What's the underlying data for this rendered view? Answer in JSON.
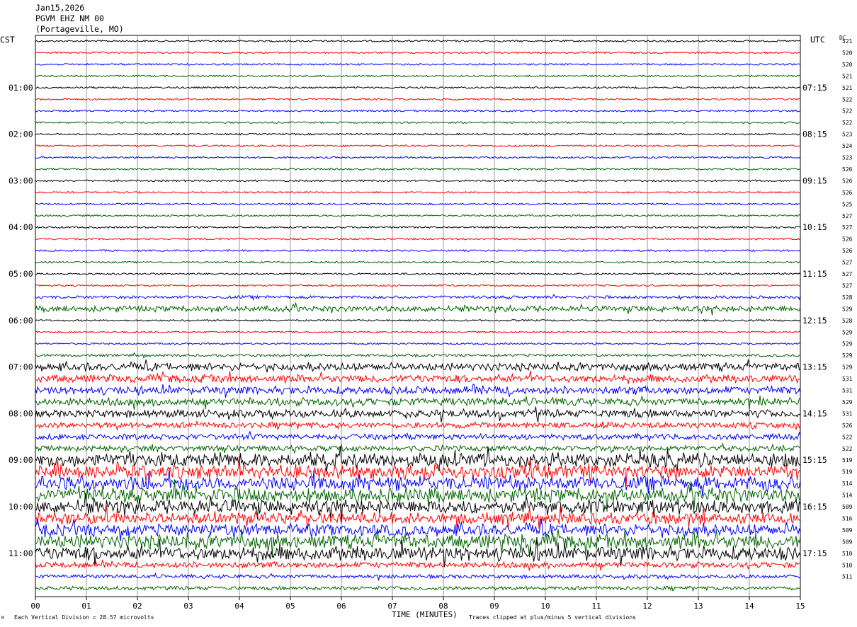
{
  "header": {
    "date": "Jan15,2026",
    "station": "PGVM EHZ NM 00",
    "location": "(Portageville, MO)"
  },
  "left_zone_label": "CST",
  "right_zone_label": "UTC",
  "dc_label": "DC",
  "footer": {
    "scale_note": "Each Vertical Division =   28.57 microvolts",
    "clip_note": "Traces clipped at plus/minus 5 vertical divisions",
    "corner_mark": "M"
  },
  "colors": {
    "trace_cycle": [
      "#000000",
      "#ff0000",
      "#0000ff",
      "#006400"
    ],
    "grid": "#808080"
  },
  "chart_data": {
    "type": "line",
    "title": "",
    "xlabel": "TIME (MINUTES)",
    "ylabel": "",
    "xlim": [
      0,
      15
    ],
    "x_ticks": [
      "00",
      "01",
      "02",
      "03",
      "04",
      "05",
      "06",
      "07",
      "08",
      "09",
      "10",
      "11",
      "12",
      "13",
      "14",
      "15"
    ],
    "rows": 48,
    "left_hour_labels": [
      {
        "row": 4,
        "label": "01:00"
      },
      {
        "row": 8,
        "label": "02:00"
      },
      {
        "row": 12,
        "label": "03:00"
      },
      {
        "row": 16,
        "label": "04:00"
      },
      {
        "row": 20,
        "label": "05:00"
      },
      {
        "row": 24,
        "label": "06:00"
      },
      {
        "row": 28,
        "label": "07:00"
      },
      {
        "row": 32,
        "label": "08:00"
      },
      {
        "row": 36,
        "label": "09:00"
      },
      {
        "row": 40,
        "label": "10:00"
      },
      {
        "row": 44,
        "label": "11:00"
      }
    ],
    "right_hour_labels": [
      {
        "row": 4,
        "label": "07:15"
      },
      {
        "row": 8,
        "label": "08:15"
      },
      {
        "row": 12,
        "label": "09:15"
      },
      {
        "row": 16,
        "label": "10:15"
      },
      {
        "row": 20,
        "label": "11:15"
      },
      {
        "row": 24,
        "label": "12:15"
      },
      {
        "row": 28,
        "label": "13:15"
      },
      {
        "row": 32,
        "label": "14:15"
      },
      {
        "row": 36,
        "label": "15:15"
      },
      {
        "row": 40,
        "label": "16:15"
      },
      {
        "row": 44,
        "label": "17:15"
      }
    ],
    "dc_offsets": [
      "521",
      "520",
      "520",
      "521",
      "521",
      "522",
      "522",
      "522",
      "523",
      "524",
      "523",
      "526",
      "526",
      "526",
      "525",
      "527",
      "527",
      "526",
      "526",
      "527",
      "527",
      "527",
      "528",
      "529",
      "528",
      "529",
      "529",
      "529",
      "529",
      "531",
      "531",
      "529",
      "531",
      "526",
      "522",
      "522",
      "519",
      "519",
      "514",
      "514",
      "509",
      "516",
      "509",
      "509",
      "510",
      "510",
      "511"
    ],
    "activity_level": [
      1,
      1,
      1,
      1,
      1,
      1,
      1,
      1,
      1,
      1,
      1,
      1,
      1,
      1,
      1,
      1,
      1,
      1,
      1,
      1,
      1,
      1,
      1.3,
      2,
      1,
      1,
      1,
      1.2,
      2.5,
      2.5,
      2.5,
      2.5,
      2.5,
      2,
      2,
      2,
      4,
      4,
      4,
      4,
      4,
      3.5,
      3.5,
      4,
      4,
      2,
      1.5,
      1.5
    ]
  }
}
